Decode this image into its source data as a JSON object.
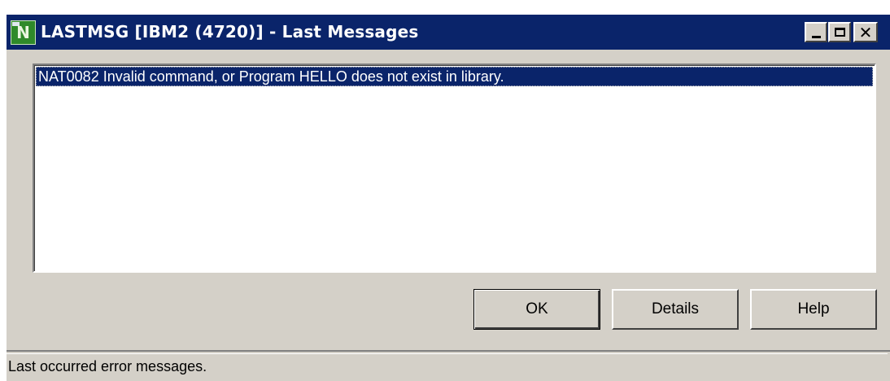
{
  "window": {
    "title": "LASTMSG [IBM2 (4720)] - Last Messages",
    "app_icon_letter": "N",
    "controls": {
      "minimize_icon": "minimize-icon",
      "maximize_icon": "maximize-icon",
      "close_icon": "close-icon",
      "close_glyph": "✕"
    }
  },
  "messages": {
    "items": [
      "NAT0082 Invalid command, or Program HELLO does not exist in library."
    ],
    "selected_index": 0
  },
  "buttons": {
    "ok": "OK",
    "details": "Details",
    "help": "Help"
  },
  "status_bar": {
    "text": "Last occurred error messages."
  },
  "colors": {
    "title_bar": "#0a246a",
    "selection": "#0a246a",
    "dialog_face": "#d4d0c8",
    "icon_green": "#2f8a2a"
  }
}
